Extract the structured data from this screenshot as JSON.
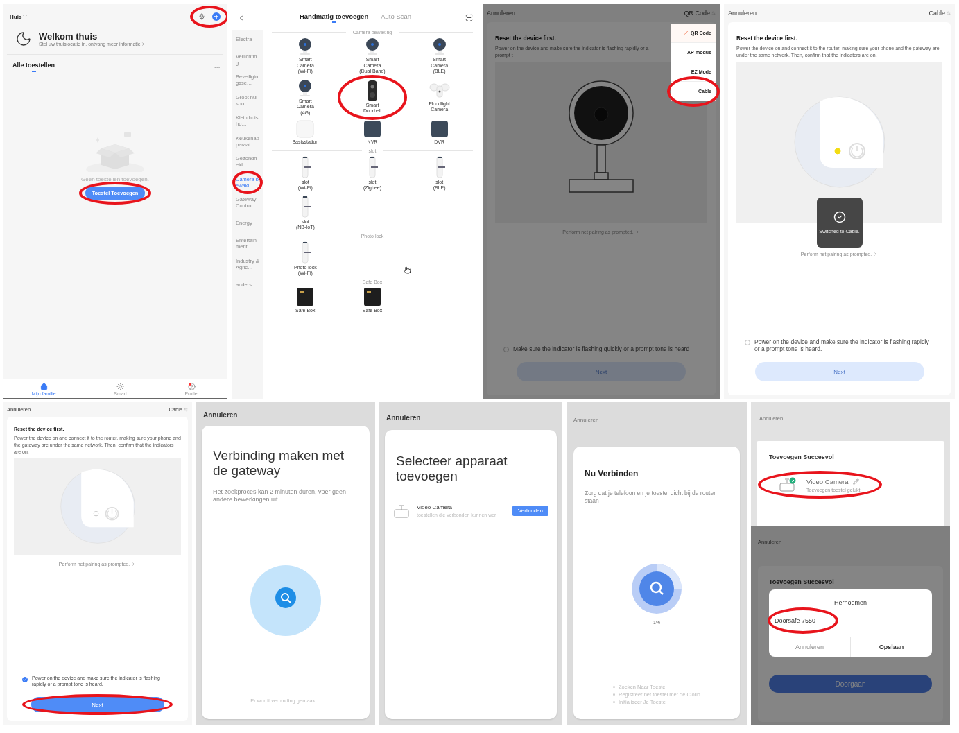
{
  "top_row": [
    {
      "kind": "home",
      "home_name": "Huis",
      "header_icons_circled": true,
      "welcome_title": "Welkom thuis",
      "welcome_subtitle": "Stel uw thuislocatie in, ontvang meer informatie",
      "section_title": "Alle toestellen",
      "empty_text": "Geen toestellen toevoegen.",
      "add_button": {
        "label": "Toestel Toevoegen",
        "circled": true
      },
      "nav": [
        {
          "label": "Mijn familie",
          "selected": true,
          "badge": false
        },
        {
          "label": "Smart",
          "selected": false,
          "badge": false
        },
        {
          "label": "Profiel",
          "selected": false,
          "badge": true
        }
      ]
    },
    {
      "kind": "catalog",
      "tabs": [
        {
          "label": "Handmatig toevoegen",
          "selected": true
        },
        {
          "label": "Auto Scan",
          "selected": false
        }
      ],
      "categories": [
        {
          "label": "Electra",
          "selected": false,
          "circled": false
        },
        {
          "label": "Verlichting",
          "selected": false,
          "circled": false
        },
        {
          "label": "Beveiligingsse…",
          "selected": false,
          "circled": false
        },
        {
          "label": "Groot huisho…",
          "selected": false,
          "circled": false
        },
        {
          "label": "Klein huisho…",
          "selected": false,
          "circled": false
        },
        {
          "label": "Keukenapparaat",
          "selected": false,
          "circled": false
        },
        {
          "label": "Gezondheid",
          "selected": false,
          "circled": false
        },
        {
          "label": "Camera bewaki…",
          "selected": true,
          "circled": true
        },
        {
          "label": "Gateway Control",
          "selected": false,
          "circled": false
        },
        {
          "label": "Energy",
          "selected": false,
          "circled": false
        },
        {
          "label": "Entertainment",
          "selected": false,
          "circled": false
        },
        {
          "label": "Industry & Agric…",
          "selected": false,
          "circled": false
        },
        {
          "label": "anders",
          "selected": false,
          "circled": false
        }
      ],
      "sections": [
        {
          "title": "Camera bewaking",
          "items": [
            {
              "label": "Smart\nCamera\n(Wi-Fi)",
              "kind": "camera",
              "circled": false
            },
            {
              "label": "Smart\nCamera\n(Dual Band)",
              "kind": "camera",
              "circled": false
            },
            {
              "label": "Smart\nCamera\n(BLE)",
              "kind": "camera",
              "circled": false
            },
            {
              "label": "Smart\nCamera\n(4G)",
              "kind": "camera",
              "circled": false
            },
            {
              "label": "Smart\nDoorbell",
              "kind": "doorbell",
              "circled": true
            },
            {
              "label": "Floodlight\nCamera",
              "kind": "floodlight",
              "circled": false
            },
            {
              "label": "Basisstation",
              "kind": "hub",
              "circled": false
            },
            {
              "label": "NVR",
              "kind": "recorder",
              "circled": false
            },
            {
              "label": "DVR",
              "kind": "recorder",
              "circled": false
            }
          ]
        },
        {
          "title": "slot",
          "items": [
            {
              "label": "slot\n(Wi-Fi)",
              "kind": "lock",
              "circled": false
            },
            {
              "label": "slot\n(Zigbee)",
              "kind": "lock",
              "circled": false
            },
            {
              "label": "slot\n(BLE)",
              "kind": "lock",
              "circled": false
            },
            {
              "label": "slot\n(NB-IoT)",
              "kind": "lock",
              "circled": false
            }
          ]
        },
        {
          "title": "Photo lock",
          "items": [
            {
              "label": "Photo lock\n(Wi-Fi)",
              "kind": "lock",
              "circled": false
            }
          ]
        },
        {
          "title": "Safe Box",
          "items": [
            {
              "label": "Safe Box",
              "kind": "safe",
              "circled": false
            },
            {
              "label": "Safe Box",
              "kind": "safe",
              "circled": false
            }
          ]
        }
      ]
    },
    {
      "kind": "reset",
      "cancel": "Annuleren",
      "mode": "QR Code",
      "dimmed": true,
      "title": "Reset the device first.",
      "description": "Power on the device and make sure the indicator is flashing rapidly or a prompt t",
      "illustration": {
        "kind": "camera"
      },
      "link": "Perform net pairing as prompted.",
      "confirm": {
        "text": "Make sure the indicator is flashing quickly or a prompt tone is heard",
        "checked": false
      },
      "next": {
        "label": "Next",
        "enabled": false,
        "circled": false
      },
      "menu": [
        {
          "label": "QR Code",
          "selected": true,
          "circled": false
        },
        {
          "label": "AP-modus",
          "selected": false,
          "circled": false
        },
        {
          "label": "EZ Mode",
          "selected": false,
          "circled": false
        },
        {
          "label": "Cable",
          "selected": false,
          "circled": true
        }
      ]
    },
    {
      "kind": "reset",
      "cancel": "Annuleren",
      "mode": "Cable",
      "dimmed": false,
      "title": "Reset the device first.",
      "description": "Power the device on and connect it to the router, making sure your phone and the gateway are under the same network. Then, confirm that the indicators are on.",
      "illustration": {
        "kind": "indicator"
      },
      "indicator_on": true,
      "toast": "Switched to Cable.",
      "link": "Perform net pairing as prompted.",
      "confirm": {
        "text": "Power on the device and make sure the indicator is flashing rapidly or a prompt tone is heard.",
        "checked": false
      },
      "next": {
        "label": "Next",
        "enabled": false,
        "circled": false
      }
    }
  ],
  "bottom_row": [
    {
      "kind": "reset",
      "cancel": "Annuleren",
      "mode": "Cable",
      "dimmed": false,
      "title": "Reset the device first.",
      "description": "Power the device on and connect it to the router, making sure your phone and the gateway are under the same network. Then, confirm that the indicators are on.",
      "illustration": {
        "kind": "indicator"
      },
      "indicator_on": false,
      "link": "Perform net pairing as prompted.",
      "confirm": {
        "text": "Power on the device and make sure the indicator is flashing rapidly or a prompt tone is heard.",
        "checked": true
      },
      "next": {
        "label": "Next",
        "enabled": true,
        "circled": true
      }
    },
    {
      "kind": "gateway_search",
      "cancel": "Annuleren",
      "title": "Verbinding maken met de gateway",
      "subtitle": "Het zoekproces kan 2 minuten duren, voer geen andere bewerkingen uit",
      "status": "Er wordt verbinding gemaakt..."
    },
    {
      "kind": "select_device",
      "cancel": "Annuleren",
      "title": "Selecteer apparaat toevoegen",
      "device": {
        "name": "Video Camera",
        "hint": "toestellen die verbonden kunnen wor",
        "action": "Verbinden"
      }
    },
    {
      "kind": "connecting",
      "cancel": "Annuleren",
      "title": "Nu Verbinden",
      "subtitle": "Zorg dat je telefoon en je toestel dicht bij de router staan",
      "percent": "1%",
      "steps": [
        "Zoeken Naar Toestel",
        "Registreer het toestel met de Cloud",
        "Initialiseer Je Toestel"
      ]
    },
    {
      "kind": "stack",
      "screens": [
        {
          "kind": "success",
          "cancel": "Annuleren",
          "title": "Toevoegen Succesvol",
          "device": {
            "name": "Video Camera",
            "status": "Toevoegen toestel gelukt.",
            "circled": true
          }
        },
        {
          "kind": "rename",
          "cancel": "Annuleren",
          "dimmed": true,
          "title": "Toevoegen Succesvol",
          "dialog": {
            "title": "Hernoemen",
            "value": "Doorsafe 7550",
            "value_circled": true,
            "cancel": "Annuleren",
            "save": "Opslaan"
          },
          "continue": "Doorgaan"
        }
      ]
    }
  ]
}
